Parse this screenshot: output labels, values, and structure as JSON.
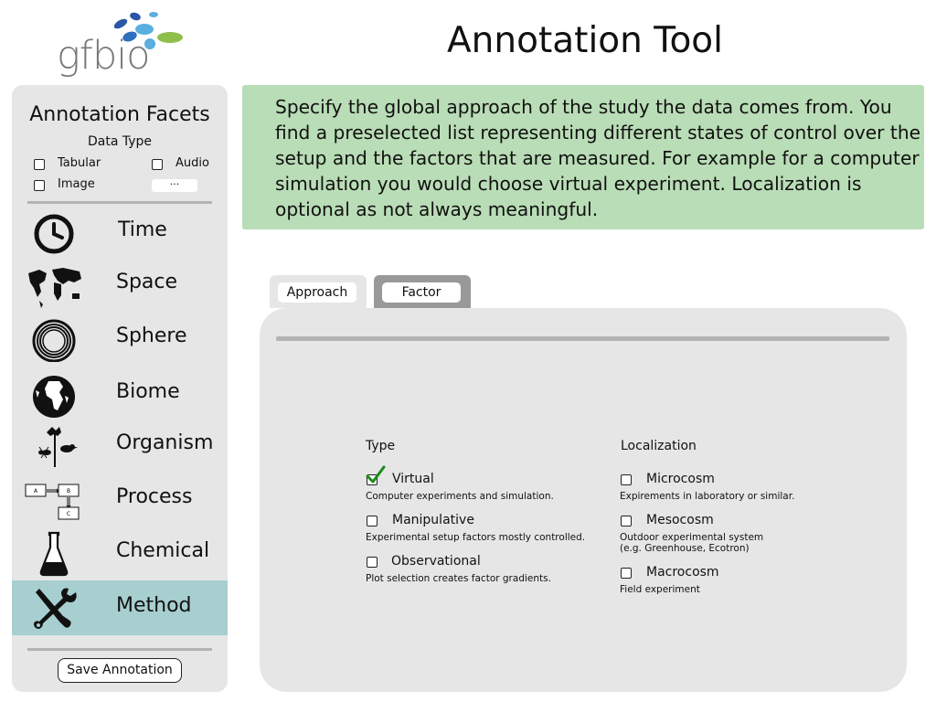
{
  "header": {
    "logo_text": "gfbio",
    "title": "Annotation Tool"
  },
  "sidebar": {
    "title": "Annotation Facets",
    "data_type": {
      "label": "Data Type",
      "options": [
        {
          "label": "Tabular",
          "checked": false
        },
        {
          "label": "Audio",
          "checked": false
        },
        {
          "label": "Image",
          "checked": false
        }
      ],
      "more_label": "···"
    },
    "facets": [
      {
        "label": "Time",
        "icon": "clock-icon",
        "active": false
      },
      {
        "label": "Space",
        "icon": "world-map-icon",
        "active": false
      },
      {
        "label": "Sphere",
        "icon": "concentric-circles-icon",
        "active": false
      },
      {
        "label": "Biome",
        "icon": "globe-icon",
        "active": false
      },
      {
        "label": "Organism",
        "icon": "organism-icon",
        "active": false
      },
      {
        "label": "Process",
        "icon": "flow-diagram-icon",
        "active": false
      },
      {
        "label": "Chemical",
        "icon": "flask-icon",
        "active": false
      },
      {
        "label": "Method",
        "icon": "tools-icon",
        "active": true
      }
    ],
    "process_diagram_labels": [
      "A",
      "B",
      "C"
    ],
    "save_label": "Save Annotation",
    "active_color": "#a7cfcf"
  },
  "info": {
    "text": "Specify the global approach of the study the data comes from. You find a preselected list representing different states of control over the setup and the factors that are measured. For example for a computer simulation you would choose virtual experiment. Localization is optional as not always meaningful.",
    "background": "#b9ddb6"
  },
  "tabs": [
    {
      "label": "Approach",
      "active": true
    },
    {
      "label": "Factor",
      "active": false
    }
  ],
  "panel": {
    "type": {
      "heading": "Type",
      "options": [
        {
          "label": "Virtual",
          "desc": "Computer experiments and simulation.",
          "checked": true
        },
        {
          "label": "Manipulative",
          "desc": "Experimental setup factors mostly controlled.",
          "checked": false
        },
        {
          "label": "Observational",
          "desc": "Plot selection creates factor gradients.",
          "checked": false
        }
      ]
    },
    "localization": {
      "heading": "Localization",
      "options": [
        {
          "label": "Microcosm",
          "desc": "Expirements in laboratory or similar.",
          "checked": false
        },
        {
          "label": "Mesocosm",
          "desc": "Outdoor experimental system",
          "desc2": "(e.g. Greenhouse, Ecotron)",
          "checked": false
        },
        {
          "label": "Macrocosm",
          "desc": "Field experiment",
          "checked": false
        }
      ]
    },
    "check_color": "#1a8a1a"
  }
}
